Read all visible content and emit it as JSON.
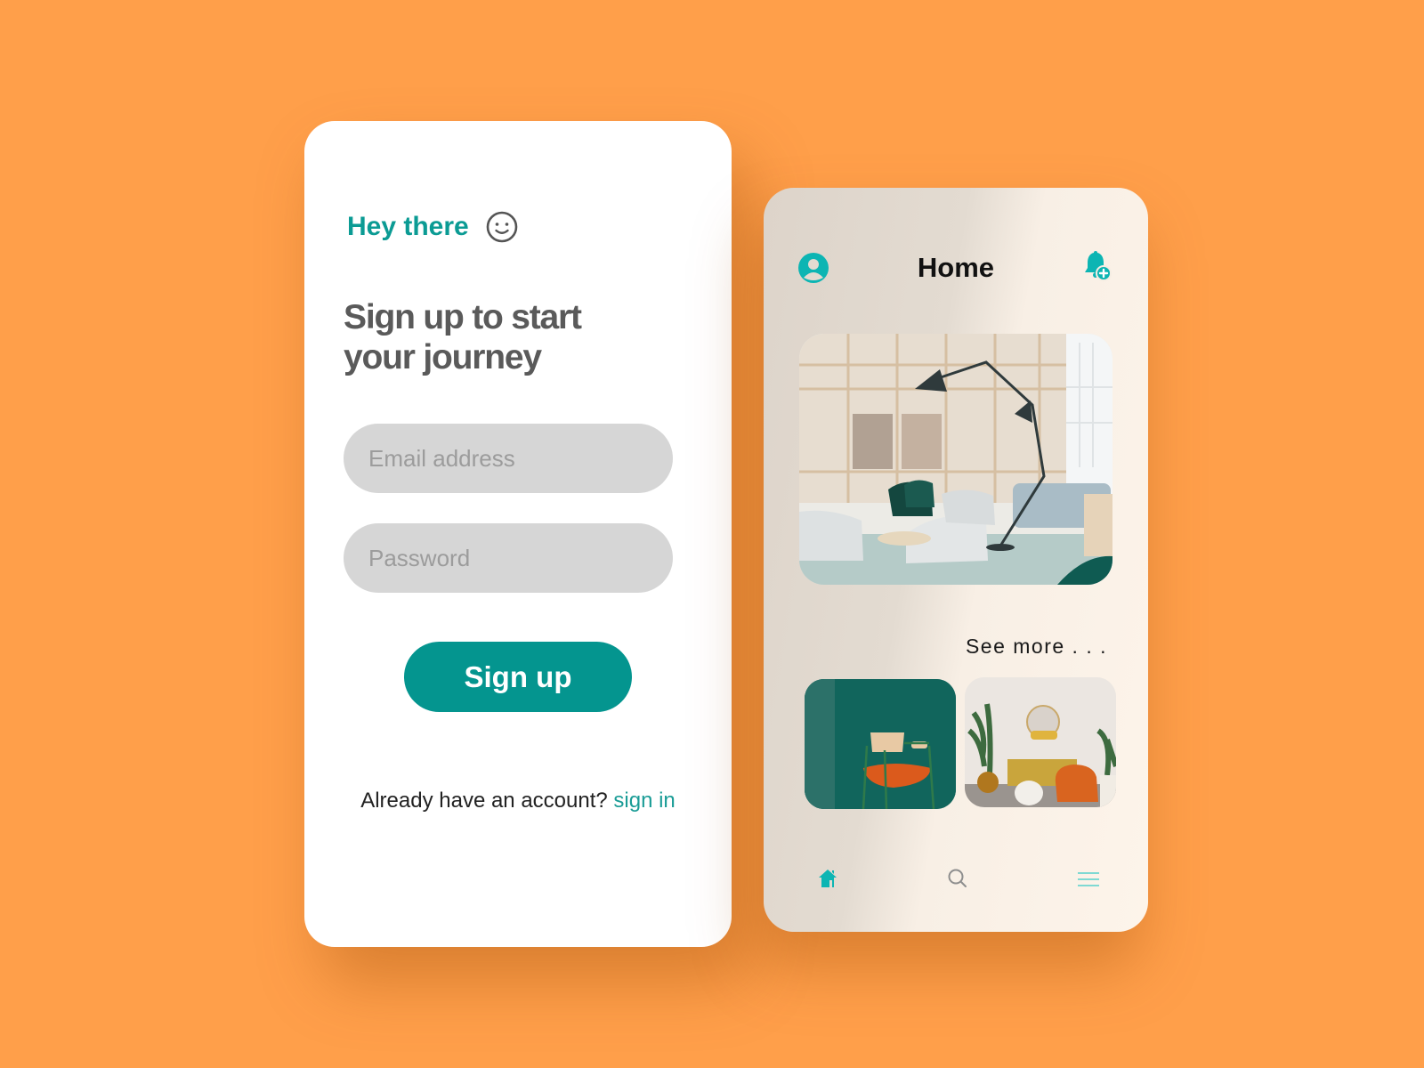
{
  "colors": {
    "background": "#ff9f4a",
    "accent": "#04958f",
    "accent_icon": "#0cb5b3",
    "headline": "#5a5a5a",
    "field_bg": "#d6d6d6"
  },
  "signup": {
    "greeting": "Hey there",
    "greeting_icon": "smiley-icon",
    "headline": "Sign up to start your journey",
    "email_placeholder": "Email address",
    "email_value": "",
    "password_placeholder": "Password",
    "password_value": "",
    "submit_label": "Sign up",
    "footer_text": "Already have an account?",
    "footer_link": "sign in"
  },
  "home": {
    "title": "Home",
    "left_icon": "avatar-icon",
    "right_icon": "bell-add-icon",
    "hero_image": "living room with floor lamp and chairs",
    "see_more": "See more . . .",
    "thumbnails": [
      {
        "label": "green wall with orange chair"
      },
      {
        "label": "living room with plants and orange armchair"
      }
    ],
    "nav": [
      {
        "icon": "home-icon",
        "active": true
      },
      {
        "icon": "search-icon",
        "active": false
      },
      {
        "icon": "menu-icon",
        "active": false
      }
    ]
  }
}
